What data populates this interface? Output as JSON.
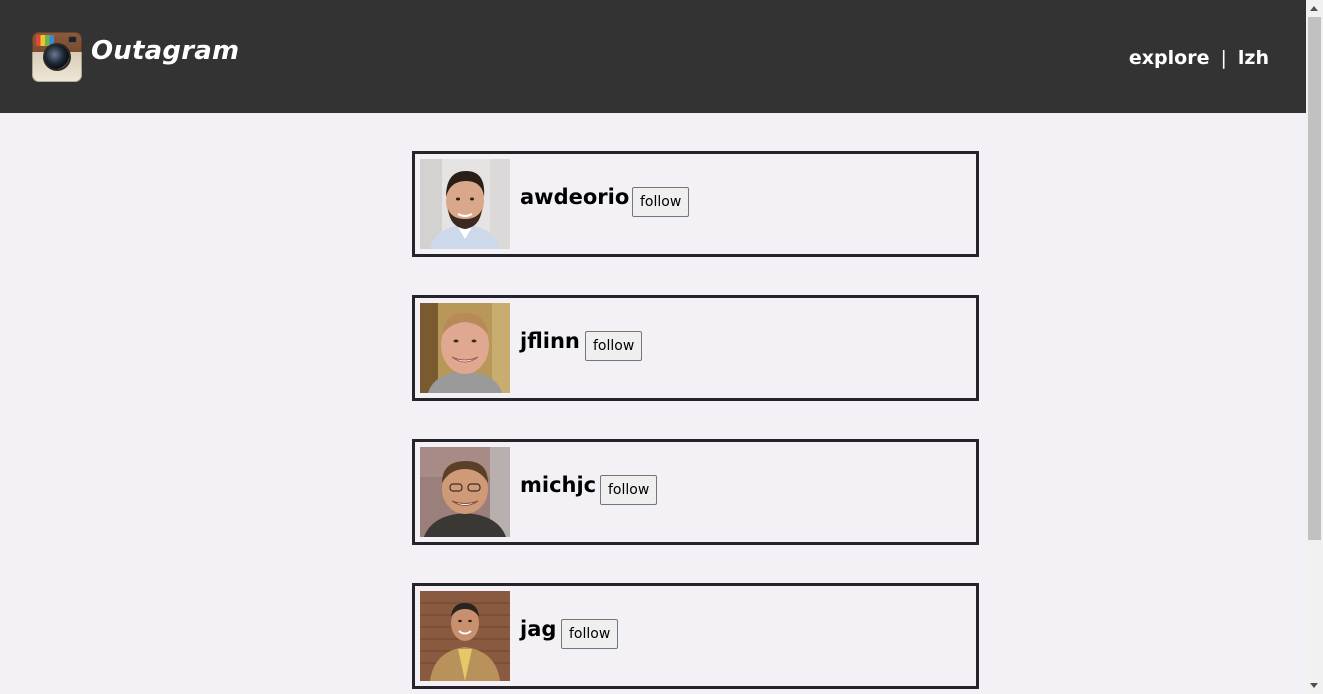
{
  "header": {
    "brand": "Outagram",
    "logo_icon": "instagram-camera-icon",
    "nav": {
      "explore": "explore",
      "separator": "|",
      "user": "lzh"
    }
  },
  "users": [
    {
      "username": "awdeorio",
      "follow_label": "follow"
    },
    {
      "username": "jflinn",
      "follow_label": "follow"
    },
    {
      "username": "michjc",
      "follow_label": "follow"
    },
    {
      "username": "jag",
      "follow_label": "follow"
    }
  ],
  "colors": {
    "header_bg": "#333333",
    "page_bg": "#f3f1f6",
    "card_border": "#26232b"
  }
}
